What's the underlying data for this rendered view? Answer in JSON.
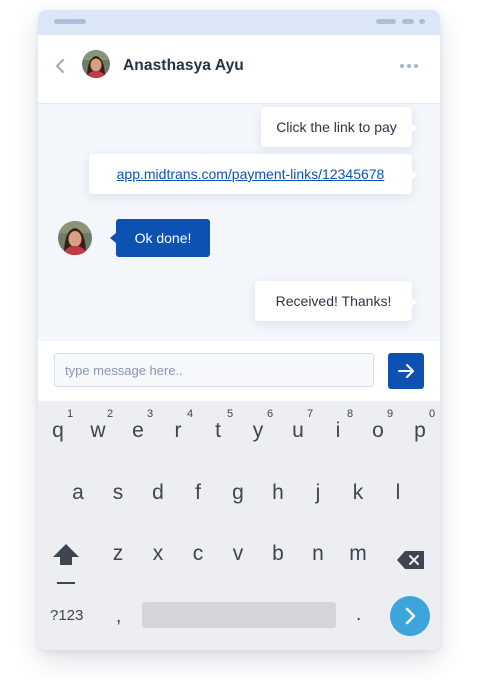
{
  "chat": {
    "contact_name": "Anasthasya Ayu",
    "messages": [
      {
        "from": "me",
        "text": "Click the link to pay"
      },
      {
        "from": "me",
        "text": "app.midtrans.com/payment-links/12345678",
        "is_link": true
      },
      {
        "from": "contact",
        "text": "Ok done!"
      },
      {
        "from": "me",
        "text": "Received! Thanks!"
      }
    ]
  },
  "composer": {
    "placeholder": "type message here.."
  },
  "keyboard": {
    "row1": [
      {
        "key": "q",
        "num": "1"
      },
      {
        "key": "w",
        "num": "2"
      },
      {
        "key": "e",
        "num": "3"
      },
      {
        "key": "r",
        "num": "4"
      },
      {
        "key": "t",
        "num": "5"
      },
      {
        "key": "y",
        "num": "6"
      },
      {
        "key": "u",
        "num": "7"
      },
      {
        "key": "i",
        "num": "8"
      },
      {
        "key": "o",
        "num": "9"
      },
      {
        "key": "p",
        "num": "0"
      }
    ],
    "row2": [
      "a",
      "s",
      "d",
      "f",
      "g",
      "h",
      "j",
      "k",
      "l"
    ],
    "row3": [
      "z",
      "x",
      "c",
      "v",
      "b",
      "n",
      "m"
    ],
    "symbols_label": "?123",
    "comma": ",",
    "period": "."
  },
  "colors": {
    "primary": "#0d52b3",
    "enter_key": "#3da5dc",
    "status_bar": "#dbe7f7",
    "chat_bg": "#f3f6fb",
    "keyboard_bg": "#eceef2"
  },
  "icons": {
    "back": "chevron-left-icon",
    "more": "more-horizontal-icon",
    "send": "arrow-right-icon",
    "shift": "shift-arrow-icon",
    "backspace": "backspace-icon",
    "enter": "chevron-right-icon"
  }
}
